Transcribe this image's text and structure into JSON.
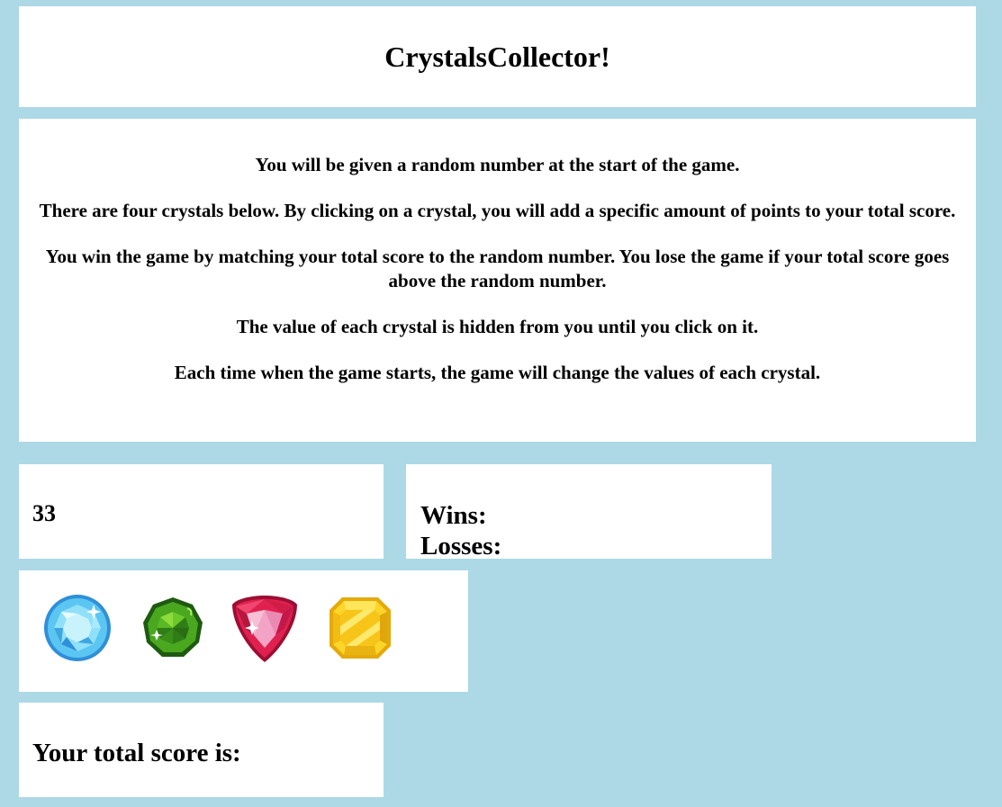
{
  "title": "CrystalsCollector!",
  "instructions": [
    "You will be given a random number at the start of the game.",
    "There are four crystals below. By clicking on a crystal, you will add a specific amount of points to your total score.",
    "You win the game by matching your total score to the random number. You lose the game if your total score goes above the random number.",
    "The value of each crystal is hidden from you until you click on it.",
    "Each time when the game starts, the game will change the values of each crystal."
  ],
  "random_number": "33",
  "stats": {
    "wins_label": "Wins:",
    "losses_label": "Losses:"
  },
  "crystals": [
    {
      "name": "blue-diamond",
      "color": "#4fb8ee"
    },
    {
      "name": "green-gem",
      "color": "#3f9a1e"
    },
    {
      "name": "red-ruby",
      "color": "#d81b4a"
    },
    {
      "name": "yellow-gem",
      "color": "#f5c518"
    }
  ],
  "score": {
    "label": "Your total score is:"
  }
}
